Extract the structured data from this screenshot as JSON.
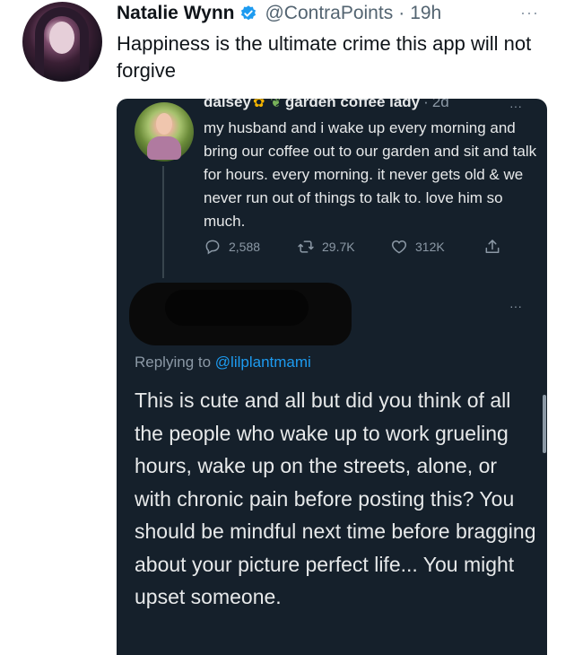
{
  "outer_tweet": {
    "name": "Natalie Wynn",
    "handle": "@ContraPoints",
    "separator": "·",
    "time": "19h",
    "text": "Happiness is the ultimate crime this app will not forgive"
  },
  "quoted_tweet": {
    "name": "daisey",
    "display_name_rest": "garden coffee lady",
    "separator": "·",
    "time": "2d",
    "text": "my husband and i wake up every morning and bring our coffee out to our garden and sit and talk for hours. every morning. it never gets old & we never run out of things to talk to. love him so much.",
    "replies": "2,588",
    "retweets": "29.7K",
    "likes": "312K"
  },
  "reply_tweet": {
    "replying_to_label": "Replying to",
    "replying_to_handle": "@lilplantmami",
    "text": "This is cute and all but did you think of all the people who wake up to work grueling hours, wake up on the streets, alone, or with chronic pain before posting this? You should be mindful next time before bragging about your picture perfect life... You might upset someone."
  },
  "more_label": "···",
  "colors": {
    "card_background": "#15202b",
    "verified_blue": "#1d9bf0",
    "mention_blue": "#1d9bf0",
    "muted_text": "#8b98a5"
  },
  "icons": [
    "verified-badge-icon",
    "sunflower-icon",
    "seedling-icon",
    "reply-icon",
    "retweet-icon",
    "heart-icon",
    "share-icon",
    "more-icon"
  ]
}
